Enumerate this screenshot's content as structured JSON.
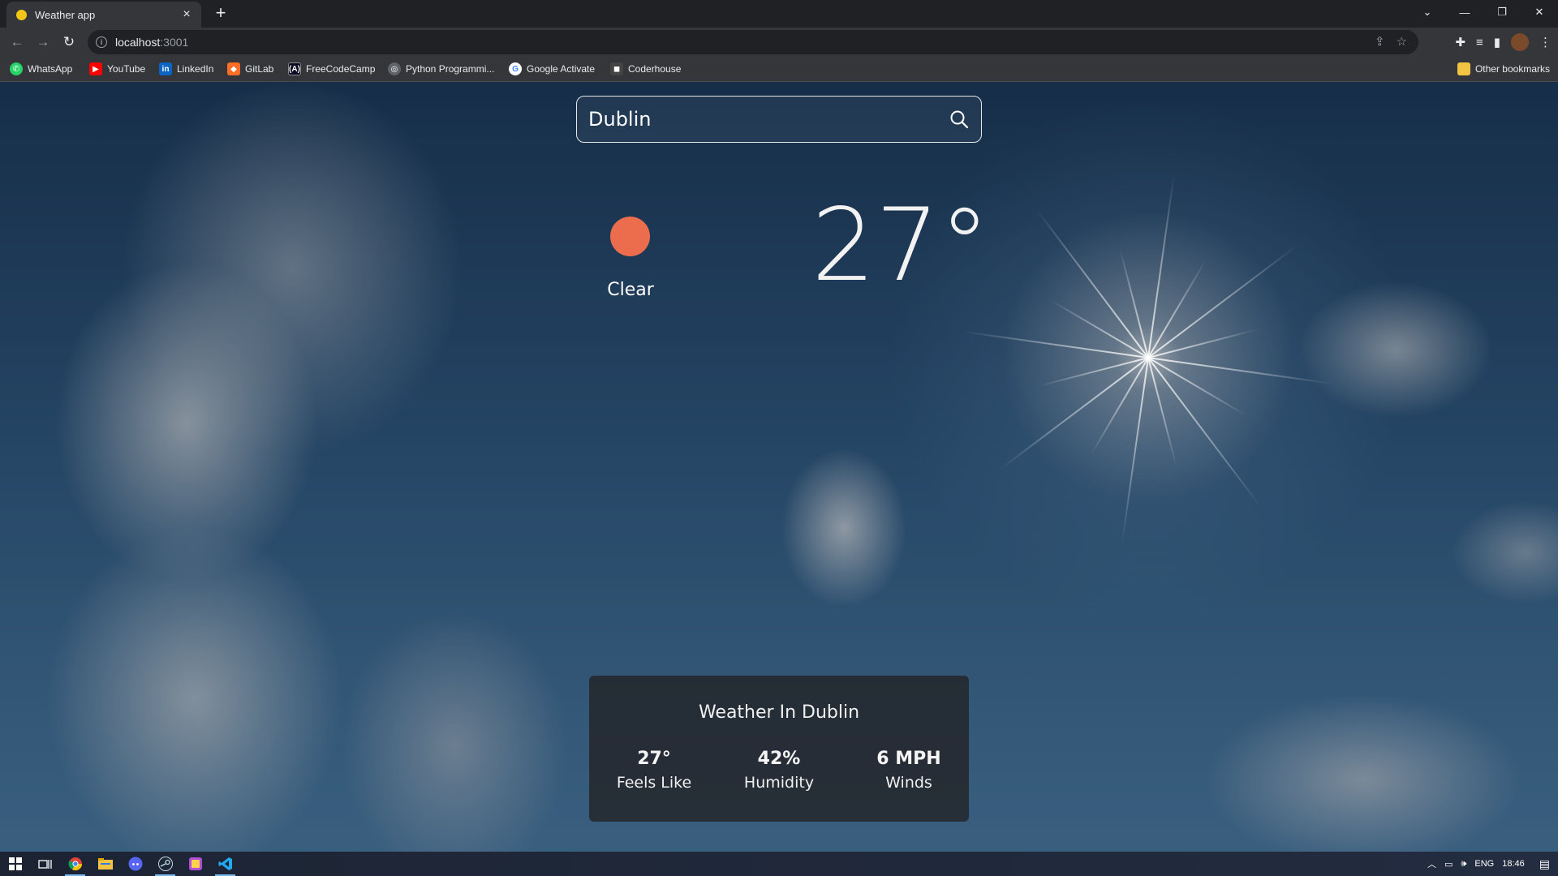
{
  "browser": {
    "tab_title": "Weather app",
    "new_tab": "+",
    "url_host": "localhost",
    "url_port": ":3001",
    "bookmarks": [
      {
        "label": "WhatsApp",
        "icon": "whatsapp-icon",
        "color": "#25d366"
      },
      {
        "label": "YouTube",
        "icon": "youtube-icon",
        "color": "#ff0000"
      },
      {
        "label": "LinkedIn",
        "icon": "linkedin-icon",
        "color": "#0a66c2"
      },
      {
        "label": "GitLab",
        "icon": "gitlab-icon",
        "color": "#fc6d26"
      },
      {
        "label": "FreeCodeCamp",
        "icon": "freecodecamp-icon",
        "color": "#0a0a23"
      },
      {
        "label": "Python Programmi...",
        "icon": "globe-icon",
        "color": "#5f6368"
      },
      {
        "label": "Google Activate",
        "icon": "google-icon",
        "color": "#ffffff"
      },
      {
        "label": "Coderhouse",
        "icon": "coderhouse-icon",
        "color": "#444444"
      }
    ],
    "other_bookmarks": "Other bookmarks"
  },
  "search": {
    "value": "Dublin"
  },
  "current": {
    "condition": "Clear",
    "temperature": "27°",
    "icon_color": "#ec6d4e"
  },
  "details": {
    "title": "Weather In Dublin",
    "stats": [
      {
        "value": "27°",
        "label": "Feels Like"
      },
      {
        "value": "42%",
        "label": "Humidity"
      },
      {
        "value": "6 MPH",
        "label": "Winds"
      }
    ]
  },
  "taskbar": {
    "language": "ENG",
    "time": "18:46"
  }
}
